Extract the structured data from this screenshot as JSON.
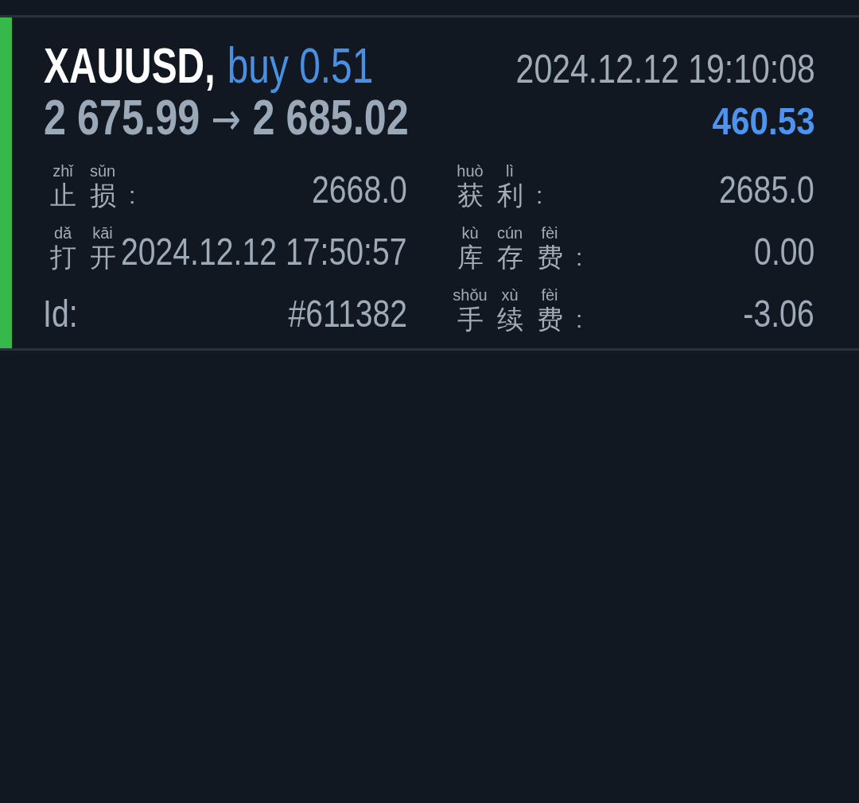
{
  "deals": [
    {
      "color": "#36b94a",
      "symbol": "XAUUSD,",
      "volume": "buy 0.51",
      "close_time": "2024.12.12 19:10:08",
      "open_price": "2 675.99",
      "arrow": "→",
      "close_price": "2 685.02",
      "profit": "460.53",
      "field_rows": [
        {
          "fields": [
            {
              "kind": "ruby",
              "label": [
                {
                  "text": "止",
                  "pinyin": "zhǐ"
                },
                {
                  "text": "损",
                  "pinyin": "sǔn"
                },
                {
                  "text": ":"
                }
              ],
              "value": "2668.0"
            },
            {
              "kind": "ruby",
              "label": [
                {
                  "text": "获",
                  "pinyin": "huò"
                },
                {
                  "text": "利",
                  "pinyin": "lì"
                },
                {
                  "text": ":"
                }
              ],
              "value": "2685.0"
            }
          ]
        },
        {
          "fields": [
            {
              "kind": "ruby",
              "label": [
                {
                  "text": "打",
                  "pinyin": "dǎ"
                },
                {
                  "text": "开",
                  "pinyin": "kāi"
                }
              ],
              "value": "2024.12.12 17:50:57"
            },
            {
              "kind": "ruby",
              "label": [
                {
                  "text": "库",
                  "pinyin": "kù"
                },
                {
                  "text": "存",
                  "pinyin": "cún"
                },
                {
                  "text": "费",
                  "pinyin": "fèi"
                },
                {
                  "text": ":"
                }
              ],
              "value": "0.00"
            }
          ]
        },
        {
          "fields": [
            {
              "kind": "plain",
              "label": "Id:",
              "value": "#611382"
            },
            {
              "kind": "ruby",
              "label": [
                {
                  "text": "手",
                  "pinyin": "shǒu"
                },
                {
                  "text": "续",
                  "pinyin": "xù"
                },
                {
                  "text": "费",
                  "pinyin": "fèi"
                },
                {
                  "text": ":"
                }
              ],
              "value": "-3.06"
            }
          ]
        }
      ]
    }
  ]
}
